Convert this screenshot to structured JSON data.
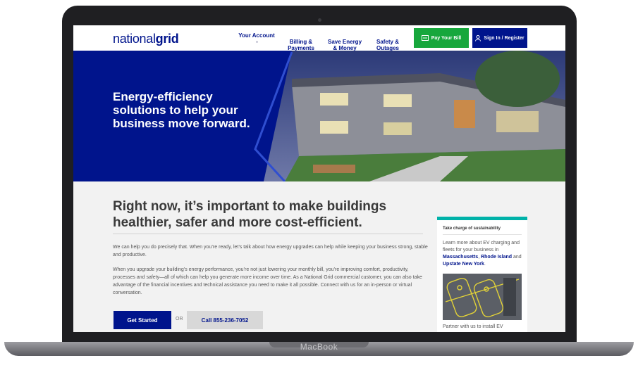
{
  "device": {
    "brand": "MacBook"
  },
  "nav": {
    "logo_light": "national",
    "logo_bold": "grid",
    "items": [
      {
        "label": "Your Account"
      },
      {
        "label": "Billing &\nPayments"
      },
      {
        "label": "Save Energy\n& Money"
      },
      {
        "label": "Safety &\nOutages"
      }
    ],
    "pay_label": "Pay Your Bill",
    "sign_label": "Sign In / Register"
  },
  "hero": {
    "title": "Energy-efficiency solutions to help your business move forward."
  },
  "main": {
    "headline": "Right now, it’s important to make buildings healthier, safer and more cost-efficient.",
    "p1": "We can help you do precisely that. When you’re ready, let’s talk about how energy upgrades can help while keeping your business strong, stable and productive.",
    "p2": "When you upgrade your building’s energy performance, you’re not just lowering your monthly bill, you’re improving comfort, productivity, processes and safety—all of which can help you generate more income over time.  As a National Grid commercial customer, you can also take advantage of the financial incentives and technical assistance you need to make it all possible.  Connect with us for an in-person or virtual conversation.",
    "start_label": "Get Started",
    "or_label": "OR",
    "call_label": "Call 855-236-7052"
  },
  "sidebar": {
    "title": "Take charge of sustainability",
    "text_pre": "Learn more about EV charging and fleets for your business in ",
    "link1": "Massachusetts",
    "sep": ", ",
    "link2": "Rhode Island",
    "and": " and ",
    "link3": "Upstate New York",
    "text_post": ".",
    "footer": "Partner with us to install EV"
  },
  "colors": {
    "brand_blue": "#00148c",
    "green": "#17a73c",
    "teal": "#00b2a9"
  }
}
